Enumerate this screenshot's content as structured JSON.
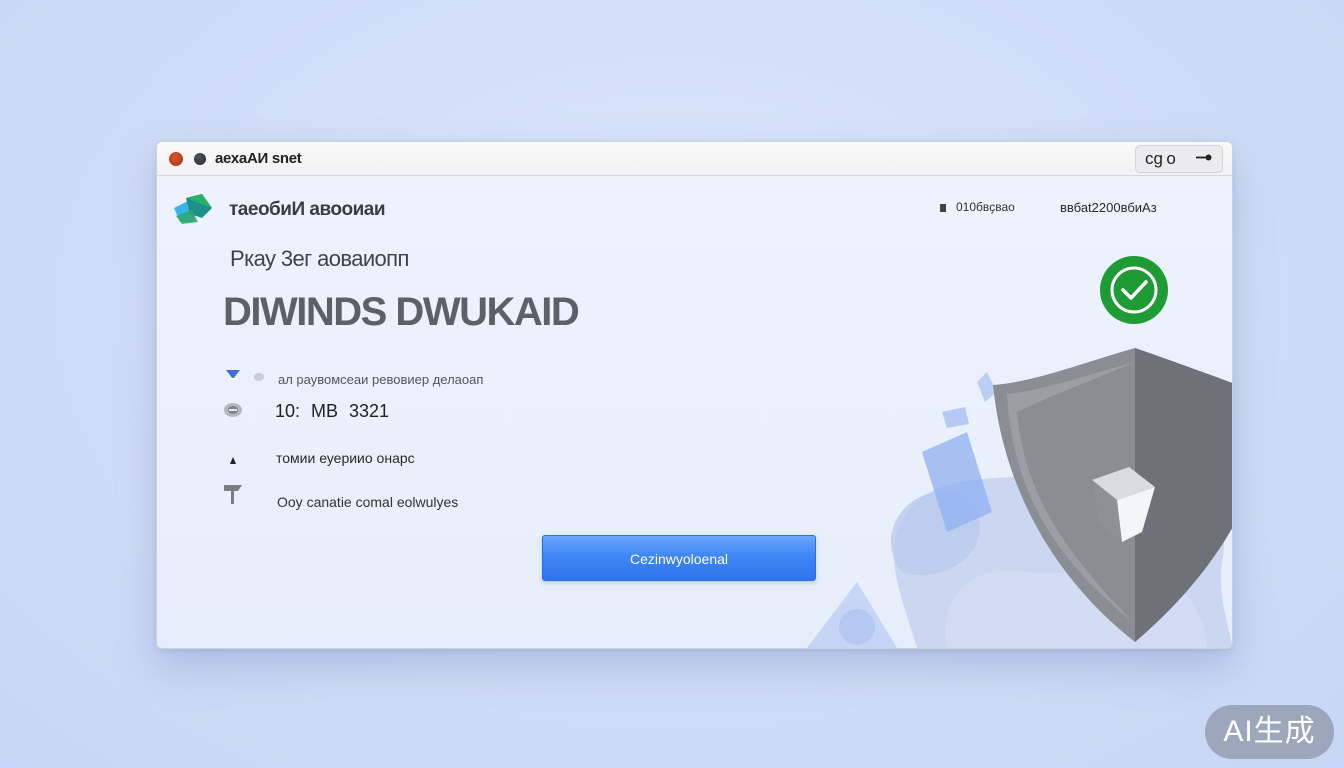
{
  "window": {
    "title": "аехаАИ snet",
    "title_control_text": "cg o",
    "app_name": "таеобиИ авооиаи",
    "header_right_1": "010бвҫвао",
    "header_right_2": "ввбаt2200вбиАз",
    "subtitle": "Ркау 3ег аоваиопп",
    "headline": "DIWINDS DWUKAID"
  },
  "info_rows": [
    {
      "icon": "chevron-down-icon",
      "label": "ал раувомсеаи ревовиер делаоап"
    },
    {
      "icon": "disk-icon",
      "label": "10:  MB   3321"
    },
    {
      "icon": "user-icon",
      "label": "томии еуериио онарс"
    },
    {
      "icon": "flag-icon",
      "label": "Ooy canatie comal eolwulyes"
    }
  ],
  "primary_button": {
    "label": "Cezinwyoloenal"
  },
  "watermark": "AI生成",
  "colors": {
    "background": "#d0ddf8",
    "window": "#eef3fc",
    "accent": "#3f86f5",
    "success": "#1f9e3a",
    "shield": "#8a8d94"
  }
}
